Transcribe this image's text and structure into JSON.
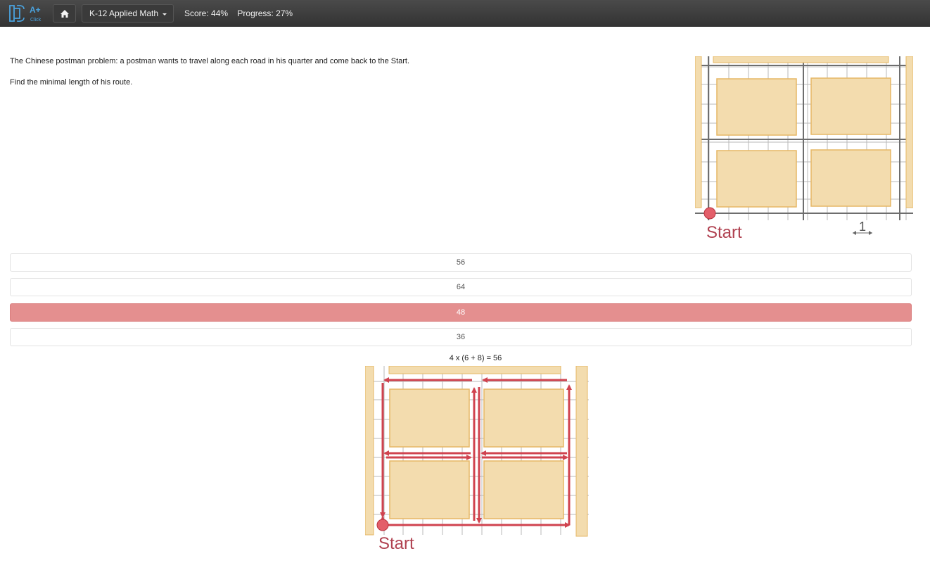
{
  "header": {
    "logo_text": "A+",
    "logo_subtext": "Click",
    "course": "K-12 Applied Math",
    "score_label": "Score: 44%",
    "progress_label": "Progress: 27%"
  },
  "question": {
    "line1": "The Chinese postman problem: a postman wants to travel along each road in his quarter and come back to the Start.",
    "line2": "Find the minimal length of his route."
  },
  "figure": {
    "start_label": "Start",
    "scale_label": "1"
  },
  "answers": [
    {
      "label": "56",
      "selected": false
    },
    {
      "label": "64",
      "selected": false
    },
    {
      "label": "48",
      "selected": true
    },
    {
      "label": "36",
      "selected": false
    }
  ],
  "explanation": {
    "formula": "4 x (6 + 8) = 56",
    "start_label": "Start"
  },
  "colors": {
    "selected": "#e48f8f",
    "route_red": "#d0434f",
    "block_fill": "#f3dcae",
    "block_border": "#e6b765"
  }
}
